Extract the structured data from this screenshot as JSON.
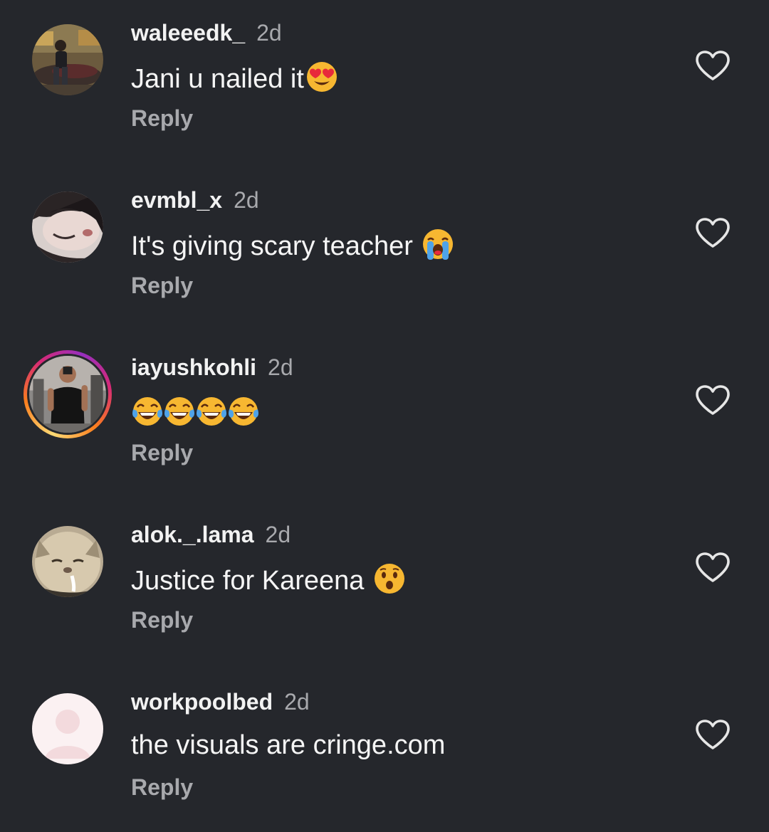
{
  "comments": [
    {
      "username": "waleeedk_",
      "time": "2d",
      "text": "Jani u nailed it",
      "emoji": [
        "heart-eyes"
      ],
      "reply_label": "Reply",
      "avatar": "photo-car",
      "has_story_ring": false
    },
    {
      "username": "evmbl_x",
      "time": "2d",
      "text": "It's giving scary teacher ",
      "emoji": [
        "loudly-crying"
      ],
      "reply_label": "Reply",
      "avatar": "photo-face",
      "has_story_ring": false
    },
    {
      "username": "iayushkohli",
      "time": "2d",
      "text": "",
      "emoji": [
        "tears-of-joy",
        "tears-of-joy",
        "tears-of-joy",
        "tears-of-joy"
      ],
      "reply_label": "Reply",
      "avatar": "photo-gym",
      "has_story_ring": true
    },
    {
      "username": "alok._.lama",
      "time": "2d",
      "text": "Justice for Kareena ",
      "emoji": [
        "hushed-face"
      ],
      "reply_label": "Reply",
      "avatar": "photo-cat",
      "has_story_ring": false
    },
    {
      "username": "workpoolbed",
      "time": "2d",
      "text": "the visuals are cringe.com",
      "emoji": [],
      "reply_label": "Reply",
      "avatar": "default-avatar",
      "has_story_ring": false
    }
  ],
  "colors": {
    "background": "#25272c",
    "text": "#f5f5f5",
    "muted": "#a8a9ad",
    "story_ring": [
      "#feda75",
      "#fa7e1e",
      "#d62976",
      "#962fbf"
    ]
  },
  "icons": {
    "like": "heart-outline-icon"
  }
}
